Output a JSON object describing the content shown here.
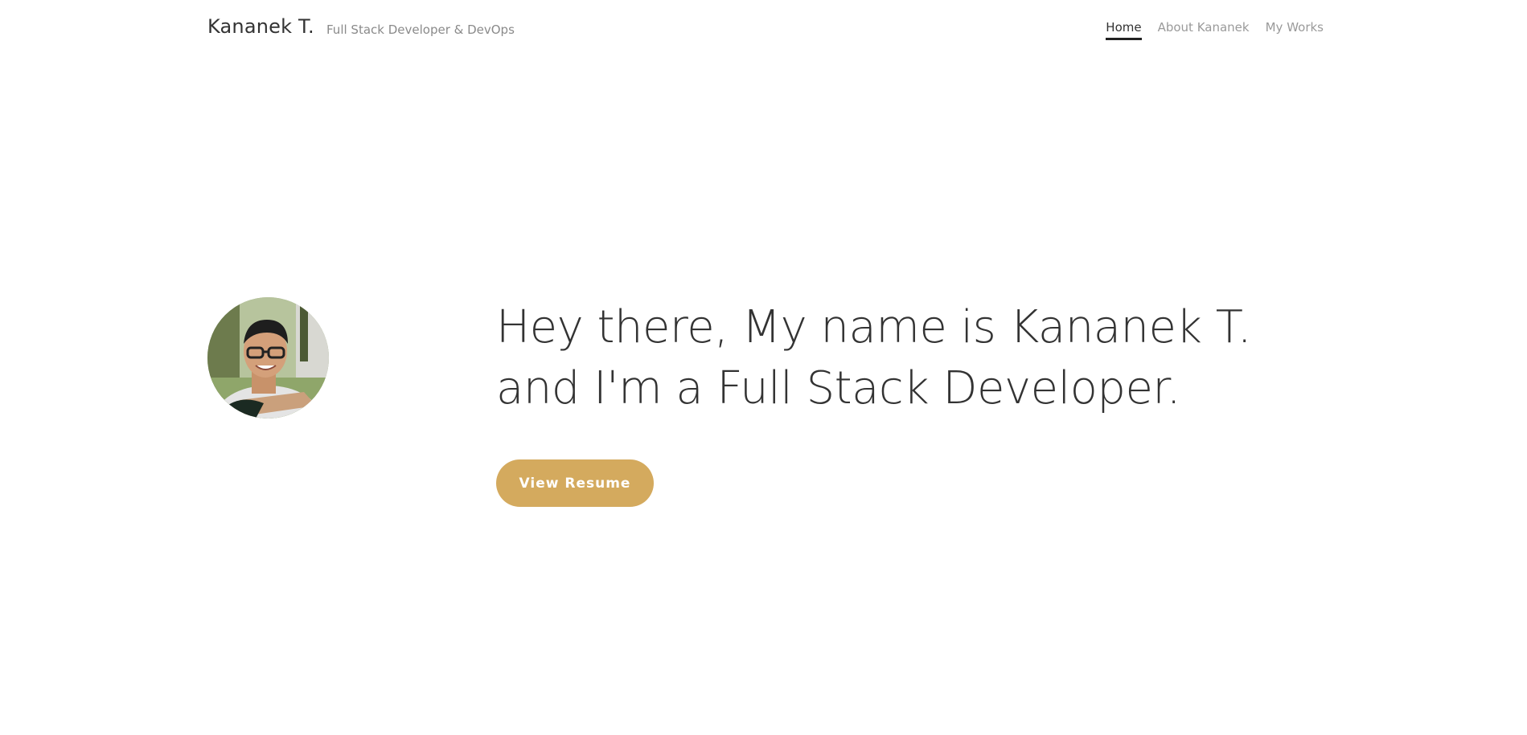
{
  "header": {
    "brand": "Kananek T.",
    "tagline": "Full Stack Developer & DevOps",
    "nav": [
      {
        "label": "Home",
        "active": true
      },
      {
        "label": "About Kananek",
        "active": false
      },
      {
        "label": "My Works",
        "active": false
      }
    ]
  },
  "hero": {
    "line1": "Hey there, My name is Kananek T.",
    "line2": "and I'm a Full Stack Developer.",
    "button_label": "View Resume",
    "avatar_icon": "profile-photo"
  },
  "colors": {
    "accent": "#d4aa5e",
    "text": "#333333",
    "muted": "#9a9a9a"
  }
}
